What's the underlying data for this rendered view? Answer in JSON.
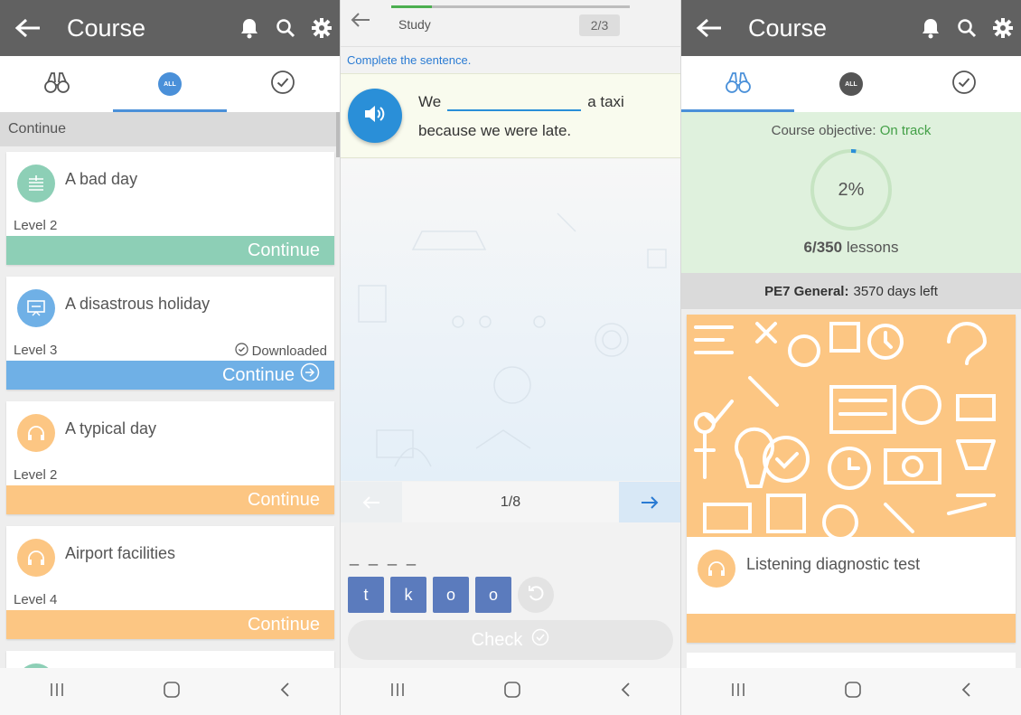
{
  "colors": {
    "header": "#616161",
    "accent_blue": "#4a90d9",
    "teal": "#8dcfb6",
    "blue": "#6fb0e6",
    "orange": "#fcc683",
    "tile": "#5b7bbd",
    "green": "#43a047"
  },
  "panel1": {
    "header": {
      "title": "Course",
      "back_icon": "arrow-left-icon",
      "icons": [
        "bell-icon",
        "search-icon",
        "gear-icon"
      ]
    },
    "tabs": [
      {
        "icon": "binoculars-icon"
      },
      {
        "icon": "all-badge-icon",
        "label": "ALL",
        "active": true
      },
      {
        "icon": "check-circle-icon"
      }
    ],
    "section_label": "Continue",
    "cards": [
      {
        "title": "A bad day",
        "level": "Level 2",
        "button": "Continue",
        "color": "teal",
        "icon": "reading-icon",
        "downloaded": ""
      },
      {
        "title": "A disastrous holiday",
        "level": "Level 3",
        "button": "Continue",
        "color": "blue",
        "icon": "presentation-icon",
        "downloaded": "Downloaded"
      },
      {
        "title": "A typical day",
        "level": "Level 2",
        "button": "Continue",
        "color": "orange",
        "icon": "headphones-icon",
        "downloaded": ""
      },
      {
        "title": "Airport facilities",
        "level": "Level 4",
        "button": "Continue",
        "color": "orange",
        "icon": "headphones-icon",
        "downloaded": ""
      }
    ]
  },
  "panel2": {
    "study_label": "Study",
    "counter": "2/3",
    "progress": 0.17,
    "instruction": "Complete the sentence.",
    "sentence": {
      "before": "We",
      "after": "a taxi",
      "line2": "because we were late."
    },
    "pager": "1/8",
    "answer_placeholder": "_ _ _ _",
    "tiles": [
      "t",
      "k",
      "o",
      "o"
    ],
    "check_label": "Check"
  },
  "panel3": {
    "header": {
      "title": "Course"
    },
    "objective_label": "Course objective:",
    "objective_status": "On track",
    "percent": "2%",
    "percent_value": 0.02,
    "lessons_done": "6/350",
    "lessons_label": "lessons",
    "course_name": "PE7 General:",
    "days_left": "3570 days left",
    "card_title": "Listening diagnostic test"
  },
  "system_nav": [
    "recents-icon",
    "home-icon",
    "back-icon"
  ]
}
